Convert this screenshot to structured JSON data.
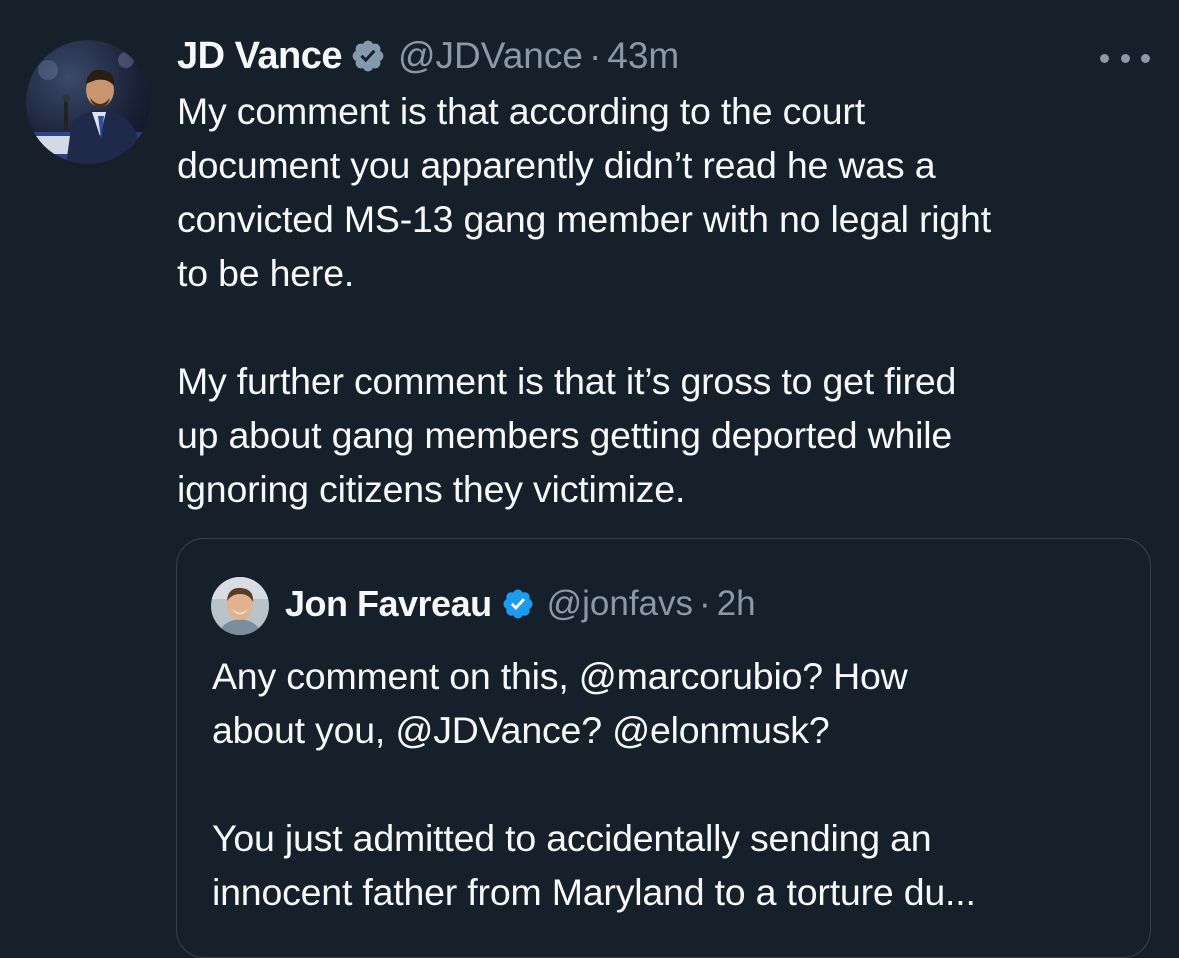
{
  "theme": {
    "background": "#15202b",
    "text_primary": "#f7f9f9",
    "text_secondary": "#8b98a5",
    "border": "#38444d",
    "verified_blue": "#1d9bf0",
    "verified_gray": "#829aab"
  },
  "tweet": {
    "author": {
      "display_name": "JD Vance",
      "handle": "@JDVance",
      "verified_badge": "gray-verified-badge-icon",
      "avatar": "jd-vance-avatar"
    },
    "separator": "·",
    "time": "43m",
    "more_icon": "more-options-icon",
    "text": {
      "paragraph1": [
        "My comment is that according to the court",
        "document you apparently didn’t read he was a",
        "convicted MS-13 gang member with no legal right",
        "to be here."
      ],
      "paragraph2": [
        "My further comment is that it’s gross to get fired",
        "up about gang members getting deported while",
        "ignoring citizens they victimize."
      ]
    },
    "quoted_tweet": {
      "author": {
        "display_name": "Jon Favreau",
        "handle": "@jonfavs",
        "verified_badge": "blue-verified-badge-icon",
        "avatar": "jon-favreau-avatar"
      },
      "separator": "·",
      "time": "2h",
      "text": {
        "paragraph1": [
          "Any comment on this, @marcorubio? How",
          "about you, @JDVance? @elonmusk?"
        ],
        "paragraph2": [
          "You just admitted to accidentally sending an",
          "innocent father from Maryland to a torture du..."
        ]
      }
    }
  }
}
